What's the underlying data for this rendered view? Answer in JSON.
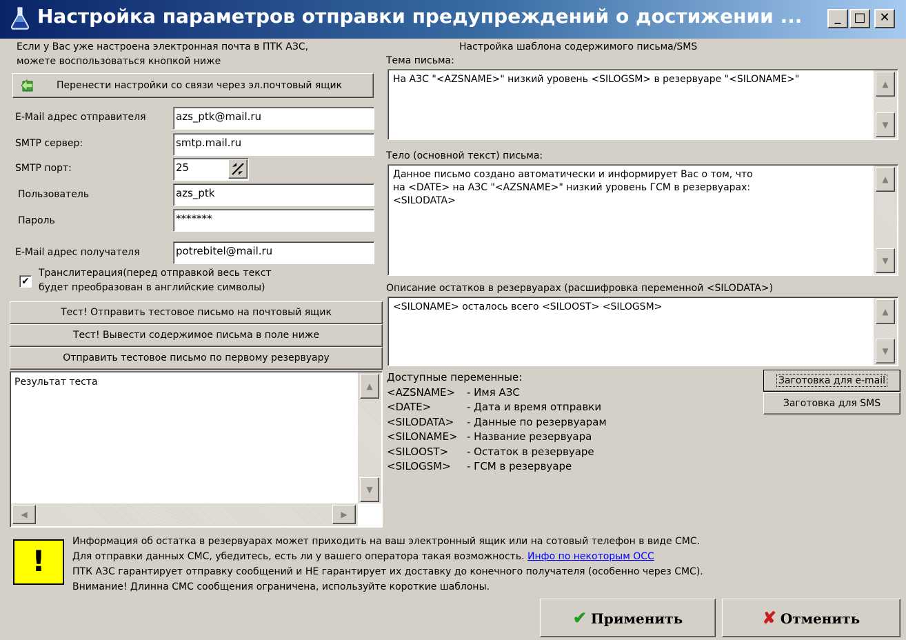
{
  "window": {
    "title": "Настройка параметров отправки предупреждений о достижении ...",
    "minimize": "_",
    "maximize": "□",
    "close": "✕"
  },
  "left": {
    "hint_line1": "Если у Вас уже настроена электронная почта в ПТК АЗС,",
    "hint_line2": "можете воспользоваться кнопкой ниже",
    "transfer_button": "Перенести настройки со связи через эл.почтовый ящик",
    "sender_label": "E-Mail адрес отправителя",
    "sender_value": "azs_ptk@mail.ru",
    "smtp_server_label": "SMTP сервер:",
    "smtp_server_value": "smtp.mail.ru",
    "smtp_port_label": "SMTP порт:",
    "smtp_port_value": "25",
    "user_label": "Пользователь",
    "user_value": "azs_ptk",
    "password_label": "Пароль",
    "password_value": "*******",
    "recipient_label": "E-Mail адрес получателя",
    "recipient_value": "potrebitel@mail.ru",
    "translit_line1": "Транслитерация(перед отправкой весь текст",
    "translit_line2": "будет преобразован в английские символы)",
    "translit_checked": "✔",
    "test_send_button": "Тест! Отправить тестовое письмо на почтовый ящик",
    "test_show_button": "Тест! Вывести содержимое письма в поле ниже",
    "test_first_silo_button": "Отправить тестовое письмо по первому резервуару",
    "result_text": "Результат теста"
  },
  "right": {
    "template_title": "Настройка шаблона содержимого письма/SMS",
    "subject_label": "Тема письма:",
    "subject_value": "На АЗС \"<AZSNAME>\" низкий уровень <SILOGSM> в резервуаре \"<SILONAME>\"",
    "body_label": "Тело (основной текст) письма:",
    "body_value": "Данное письмо создано автоматически и информирует Вас о том, что\nна <DATE> на АЗС \"<AZSNAME>\" низкий уровень ГСМ в резервуарах:\n<SILODATA>",
    "silo_label": "Описание остатков в резервуарах (расшифровка переменной <SILODATA>)",
    "silo_value": "<SILONAME> осталось всего <SILOOST> <SILOGSM>",
    "vars_title": "Доступные переменные:",
    "vars": [
      {
        "name": "<AZSNAME>",
        "desc": "- Имя АЗС"
      },
      {
        "name": "<DATE>",
        "desc": "- Дата и время отправки"
      },
      {
        "name": "<SILODATA>",
        "desc": "- Данные по резервуарам"
      },
      {
        "name": "<SILONAME>",
        "desc": "- Название резервуара"
      },
      {
        "name": "<SILOOST>",
        "desc": "- Остаток в резервуаре"
      },
      {
        "name": "<SILOGSM>",
        "desc": "- ГСМ в резервуаре"
      }
    ],
    "email_preset_button": "Заготовка для e-mail",
    "sms_preset_button": "Заготовка для SMS"
  },
  "info": {
    "line1": "Информация об остатка в резервуарах может приходить на ваш электронный ящик или на сотовый телефон в виде СМС.",
    "line2": "Для отправки данных СМС, убедитесь, есть ли у вашего оператора такая возможность.",
    "link": "Инфо по некоторым ОСС",
    "line3": "ПТК АЗС гарантирует отправку сообщений и НЕ гарантирует их доставку до конечного получателя (особенно через СМС).",
    "line4": "Внимание! Длинна СМС сообщения ограничена, используйте короткие шаблоны.",
    "warn_symbol": "!"
  },
  "footer": {
    "apply_label": "Применить",
    "cancel_label": "Отменить",
    "apply_icon": "✔",
    "cancel_icon": "✘"
  },
  "colors": {
    "title_bar_start": "#0a246a",
    "title_bar_end": "#a6caf0",
    "warning_bg": "#ffff00",
    "apply_green": "#1f9b1f",
    "cancel_red": "#c81e1e"
  }
}
